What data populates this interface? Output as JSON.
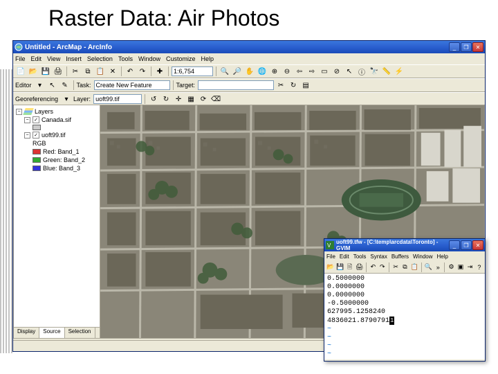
{
  "slide": {
    "title": "Raster Data: Air Photos"
  },
  "main_window": {
    "title": "Untitled - ArcMap - ArcInfo",
    "menus": [
      "File",
      "Edit",
      "View",
      "Insert",
      "Selection",
      "Tools",
      "Window",
      "Customize",
      "Help"
    ],
    "scale": "1:6,754",
    "editor_label": "Editor",
    "task_label": "Task:",
    "task_value": "Create New Feature",
    "target_label": "Target:",
    "georef_label": "Georeferencing",
    "layer_label": "Layer:",
    "layer_value": "uoft99.tif"
  },
  "toc": {
    "root": "Layers",
    "layer1": "Canada.sif",
    "layer2_name": "uoft99.tif",
    "layer2_sub": "RGB",
    "bands": [
      {
        "label": "Red: Band_1"
      },
      {
        "label": "Green: Band_2"
      },
      {
        "label": "Blue: Band_3"
      }
    ],
    "tabs": [
      "Display",
      "Source",
      "Selection"
    ]
  },
  "popup": {
    "title": "uoft99.tfw - [C:\\temp\\arcdata\\Toronto] - GVIM",
    "menus": [
      "File",
      "Edit",
      "Tools",
      "Syntax",
      "Buffers",
      "Window",
      "Help"
    ],
    "lines": [
      "0.5000000",
      "0.0000000",
      "0.0000000",
      "-0.5000000",
      "627995.1258240",
      "4836021.8790791"
    ],
    "cursor": "1"
  }
}
